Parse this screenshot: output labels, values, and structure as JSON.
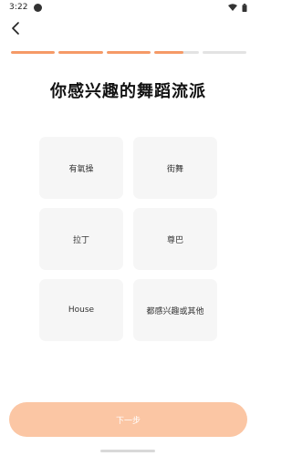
{
  "status": {
    "time": "3:22"
  },
  "header": {
    "back_icon": "back-arrow-icon"
  },
  "progress": {
    "segments": [
      1,
      1,
      1,
      0.65,
      0
    ]
  },
  "title": "你感兴趣的舞蹈流派",
  "options": [
    {
      "label": "有氧操"
    },
    {
      "label": "街舞"
    },
    {
      "label": "拉丁"
    },
    {
      "label": "尊巴"
    },
    {
      "label": "House"
    },
    {
      "label": "都感兴趣或其他"
    }
  ],
  "next_button": {
    "label": "下一步"
  },
  "colors": {
    "accent": "#f59a67",
    "accent_light": "#fbc6a4",
    "tile_bg": "#f6f6f6"
  }
}
